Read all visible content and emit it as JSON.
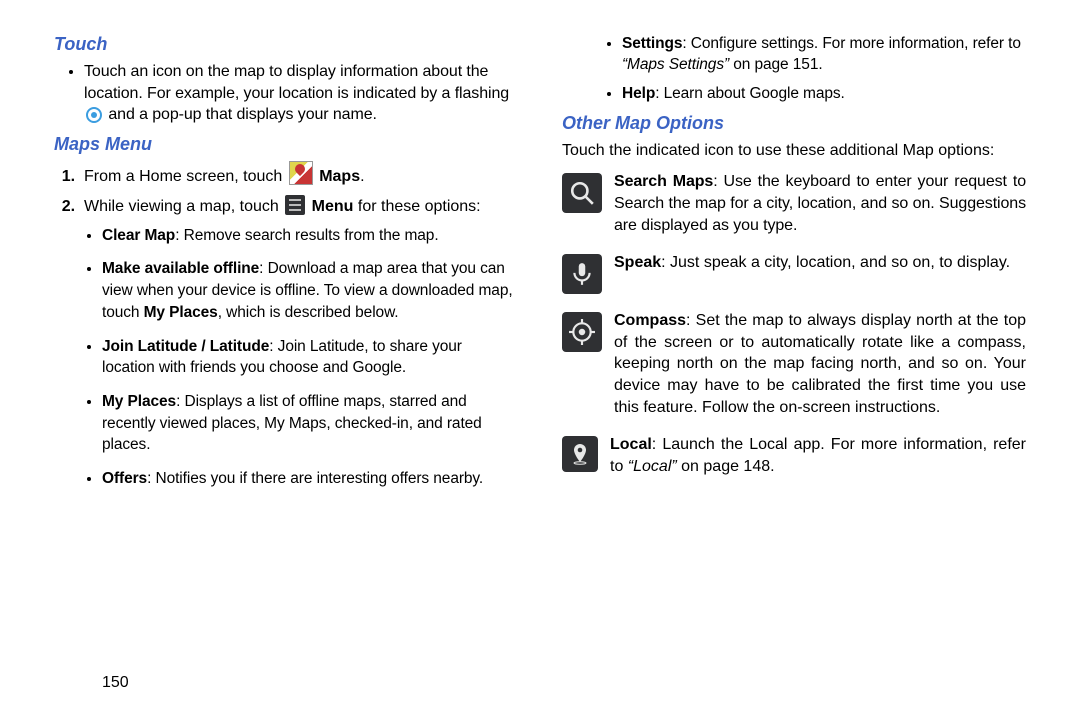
{
  "page_number": "150",
  "left": {
    "touch_heading": "Touch",
    "touch_intro_a": "Touch an icon on the map to display information about the location. For example, your location is indicated by a flashing",
    "touch_intro_b": "and a pop-up that displays your name.",
    "maps_menu_heading": "Maps Menu",
    "step1_a": "From a Home screen, touch ",
    "step1_b": "Maps",
    "step1_c": ".",
    "step2_a": "While viewing a map, touch ",
    "step2_b": "Menu",
    "step2_c": " for these options:",
    "opts": [
      {
        "bold": "Clear Map",
        "text": ": Remove search results from the map."
      },
      {
        "bold": "Make available offline",
        "text": ": Download a map area that you can view when your device is offline. To view a downloaded map, touch ",
        "bold2": "My Places",
        "tail": ", which is described below."
      },
      {
        "bold": "Join Latitude / Latitude",
        "text": ": Join Latitude, to share your location with friends you choose and Google."
      },
      {
        "bold": "My Places",
        "text": ": Displays a list of offline maps, starred and recently viewed places, My Maps, checked-in, and rated places."
      },
      {
        "bold": "Offers",
        "text": ": Notifies you if there are interesting offers nearby."
      }
    ]
  },
  "right": {
    "cont": [
      {
        "bold": "Settings",
        "text": ": Configure settings. For more information, refer to ",
        "ital": "“Maps Settings”",
        "tail": "  on page 151."
      },
      {
        "bold": "Help",
        "text": ": Learn about Google maps."
      }
    ],
    "other_heading": "Other Map Options",
    "other_intro": "Touch the indicated icon to use these additional Map options:",
    "items": [
      {
        "icon": "search",
        "bold": "Search Maps",
        "text": ": Use the keyboard to enter your request to Search the map for a city, location, and so on. Suggestions are displayed as you type."
      },
      {
        "icon": "speak",
        "bold": "Speak",
        "text": ": Just speak a city, location, and so on, to display."
      },
      {
        "icon": "compass",
        "bold": "Compass",
        "text": ": Set the map to always display north at the top of the screen or to automatically rotate like a compass, keeping north on the map facing north, and so on. Your device may have to be calibrated the first time you use this feature. Follow the on-screen instructions."
      },
      {
        "icon": "local",
        "bold": "Local",
        "text": ": Launch the Local app. For more information, refer to ",
        "ital": "“Local”",
        "tail": "  on page 148."
      }
    ]
  }
}
